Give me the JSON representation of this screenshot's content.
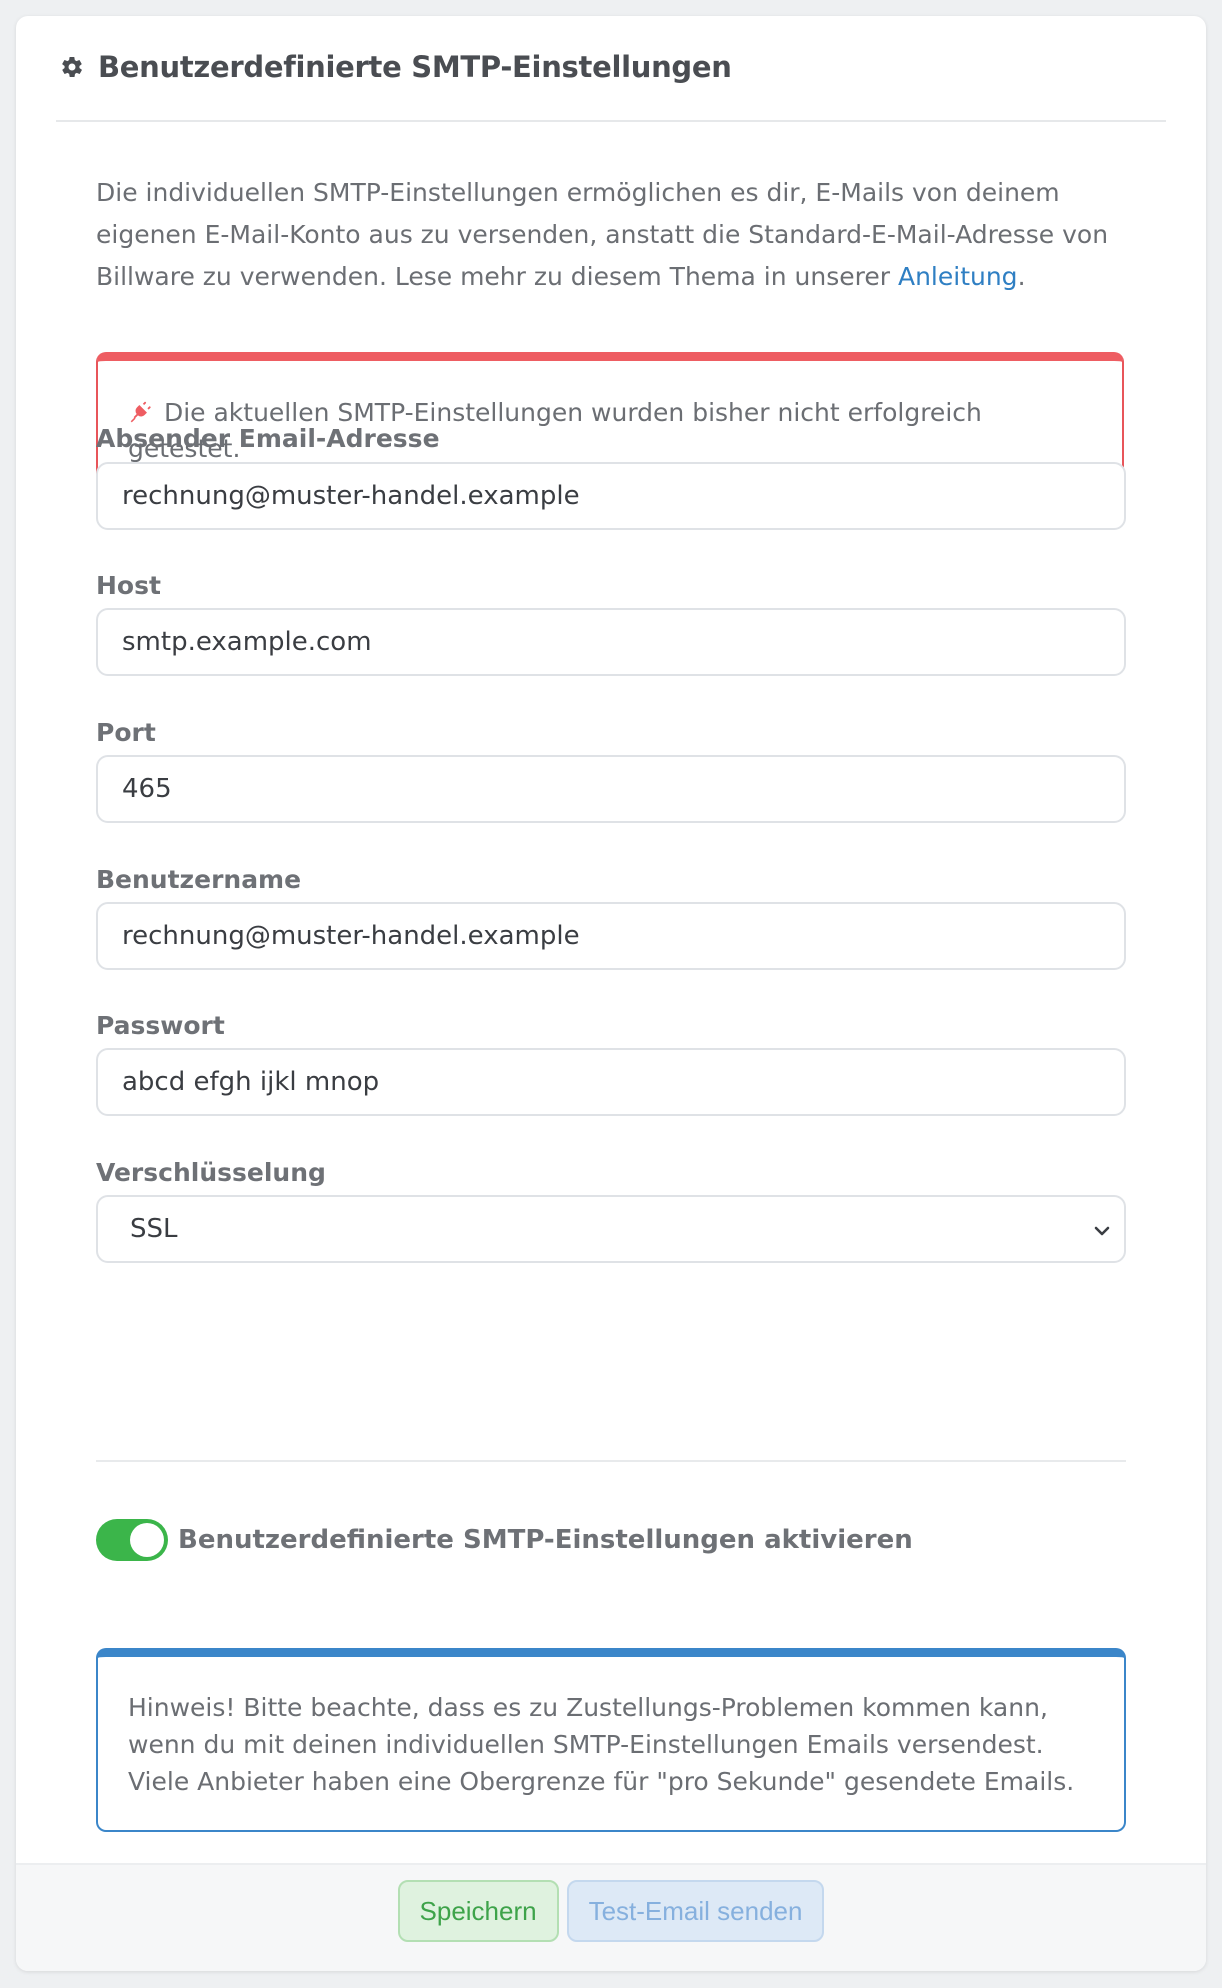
{
  "header": {
    "title": "Benutzerdefinierte SMTP-Einstellungen",
    "icon": "gear-icon"
  },
  "intro": {
    "text": "Die individuellen SMTP-Einstellungen ermöglichen es dir, E-Mails von deinem eigenen E-Mail-Konto aus zu versenden, anstatt die Standard-E-Mail-Adresse von Billware zu verwenden. Lese mehr zu diesem Thema in unserer ",
    "link_text": "Anleitung",
    "suffix": "."
  },
  "alert_danger": {
    "icon": "plug-icon",
    "text": "Die aktuellen SMTP-Einstellungen wurden bisher nicht erfolgreich getestet."
  },
  "fields": {
    "sender": {
      "label": "Absender Email-Adresse",
      "value": "rechnung@muster-handel.example"
    },
    "host": {
      "label": "Host",
      "value": "smtp.example.com"
    },
    "port": {
      "label": "Port",
      "value": "465"
    },
    "username": {
      "label": "Benutzername",
      "value": "rechnung@muster-handel.example"
    },
    "password": {
      "label": "Passwort",
      "value": "abcd efgh ijkl mnop"
    },
    "encryption": {
      "label": "Verschlüsselung",
      "value": "SSL"
    }
  },
  "toggle": {
    "label": "Benutzerdefinierte SMTP-Einstellungen aktivieren",
    "enabled": true,
    "color": "#3bb54a"
  },
  "alert_info": {
    "text": "Hinweis! Bitte beachte, dass es zu Zustellungs-Problemen kommen kann, wenn du mit deinen individuellen SMTP-Einstellungen Emails versendest. Viele Anbieter haben eine Obergrenze für \"pro Sekunde\" gesendete Emails."
  },
  "footer": {
    "save_label": "Speichern",
    "test_label": "Test-Email senden"
  },
  "colors": {
    "danger": "#ee5d62",
    "info": "#3b86c9",
    "link": "#2f7fc3"
  }
}
